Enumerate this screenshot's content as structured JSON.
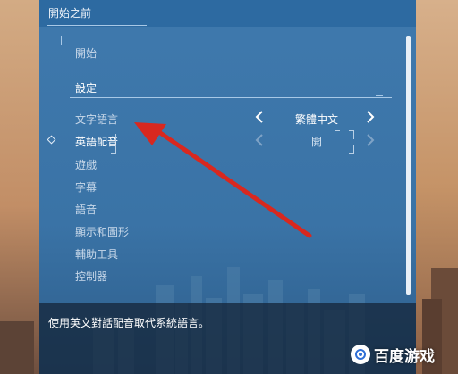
{
  "header": {
    "title": "開始之前"
  },
  "menu": {
    "items": [
      {
        "label": "開始"
      },
      {
        "label": "設定"
      },
      {
        "label": "文字語言"
      },
      {
        "label": "英語配音"
      },
      {
        "label": "遊戲"
      },
      {
        "label": "字幕"
      },
      {
        "label": "語音"
      },
      {
        "label": "顯示和圖形"
      },
      {
        "label": "輔助工具"
      },
      {
        "label": "控制器"
      }
    ]
  },
  "settings": {
    "text_language_value": "繁體中文",
    "english_voice_value": "開"
  },
  "footer": {
    "description": "使用英文對話配音取代系統語言。"
  },
  "watermark": {
    "text": "百度游戏"
  },
  "colors": {
    "panel": "#3a73a6",
    "annotation_arrow": "#d8281f"
  }
}
